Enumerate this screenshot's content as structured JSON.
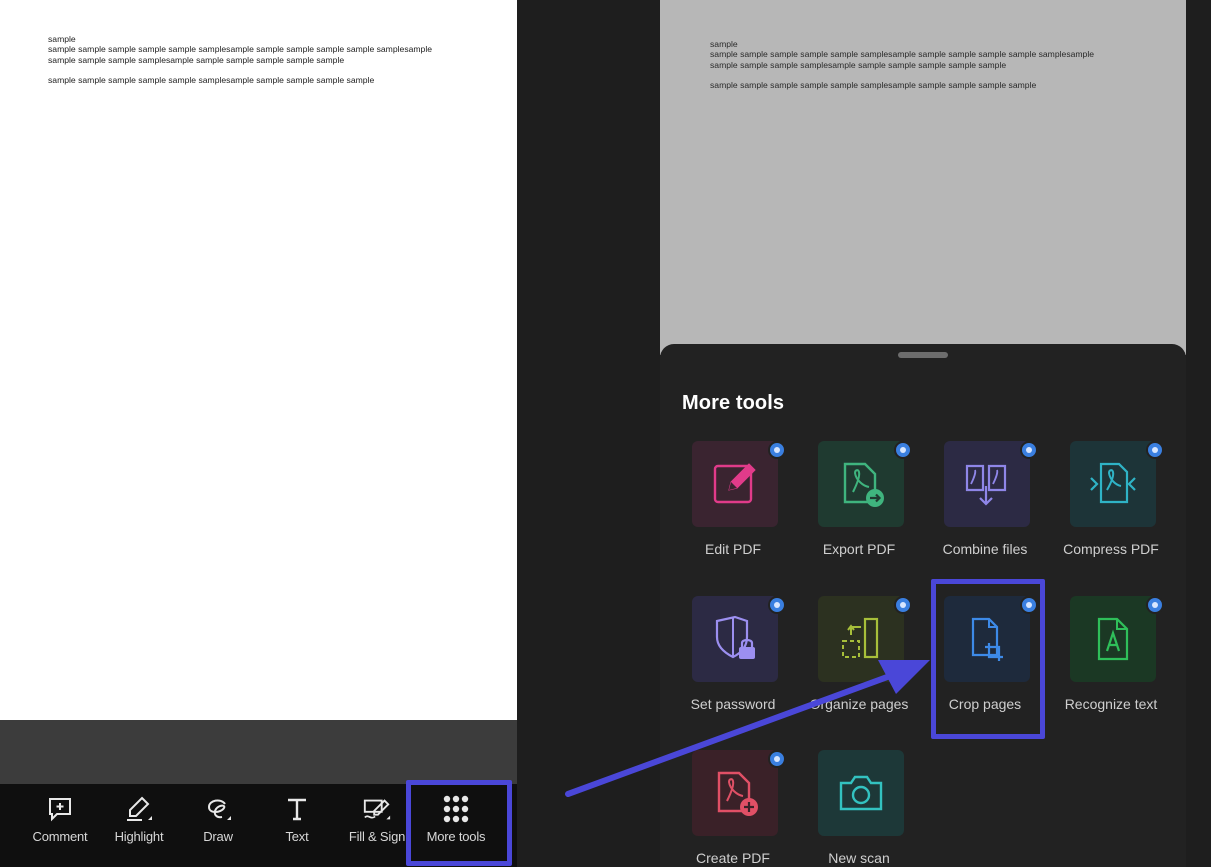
{
  "document": {
    "lines": [
      "sample",
      "sample sample sample sample sample samplesample sample sample sample sample samplesample sample sample sample samplesample sample sample sample sample sample",
      "",
      "sample sample sample sample sample samplesample sample sample sample sample"
    ]
  },
  "toolbar": {
    "items": [
      {
        "label": "Comment",
        "icon": "comment-plus-icon"
      },
      {
        "label": "Highlight",
        "icon": "highlighter-icon"
      },
      {
        "label": "Draw",
        "icon": "draw-loop-icon"
      },
      {
        "label": "Text",
        "icon": "text-T-icon"
      },
      {
        "label": "Fill & Sign",
        "icon": "fill-sign-icon"
      },
      {
        "label": "More tools",
        "icon": "grid-dots-icon"
      }
    ]
  },
  "sheet": {
    "title": "More tools",
    "tools": [
      {
        "label": "Edit PDF",
        "icon": "edit-pdf-icon",
        "color": "#e13b8a"
      },
      {
        "label": "Export PDF",
        "icon": "export-pdf-icon",
        "color": "#3fb47e"
      },
      {
        "label": "Combine files",
        "icon": "combine-files-icon",
        "color": "#8f86e8"
      },
      {
        "label": "Compress PDF",
        "icon": "compress-pdf-icon",
        "color": "#2fb3c6"
      },
      {
        "label": "Set password",
        "icon": "set-password-icon",
        "color": "#9c8ff0"
      },
      {
        "label": "Organize pages",
        "icon": "organize-pages-icon",
        "color": "#a7bf3a"
      },
      {
        "label": "Crop pages",
        "icon": "crop-pages-icon",
        "color": "#3d8ae8"
      },
      {
        "label": "Recognize text",
        "icon": "recognize-text-icon",
        "color": "#2fbf5a"
      },
      {
        "label": "Create PDF",
        "icon": "create-pdf-icon",
        "color": "#e05066"
      },
      {
        "label": "New scan",
        "icon": "camera-icon",
        "color": "#33c2c0"
      }
    ]
  },
  "colors": {
    "annotation": "#4a47d8"
  }
}
